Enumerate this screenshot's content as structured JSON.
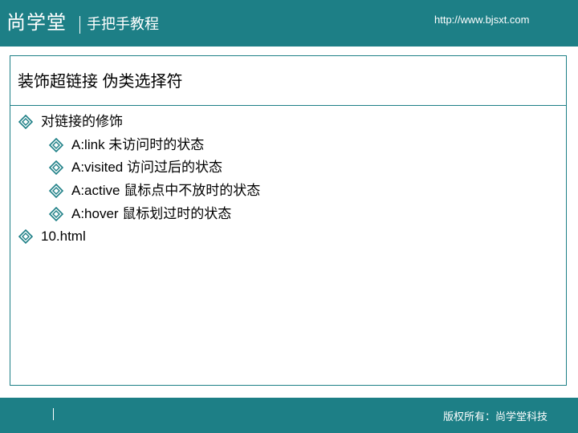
{
  "header": {
    "brand": "尚学堂",
    "tagline": "手把手教程",
    "url": "http://www.bjsxt.com"
  },
  "slide": {
    "title": "装饰超链接 伪类选择符",
    "bullets": [
      {
        "text": "对链接的修饰"
      },
      {
        "text": "A:link 未访问时的状态"
      },
      {
        "text": "A:visited 访问过后的状态"
      },
      {
        "text": "A:active 鼠标点中不放时的状态"
      },
      {
        "text": "A:hover 鼠标划过时的状态"
      },
      {
        "text": "10.html"
      }
    ],
    "bullet_icon": "diamond-bullet-icon",
    "accent_color": "#1d7f86"
  },
  "footer": {
    "copyright": "版权所有：尚学堂科技"
  }
}
